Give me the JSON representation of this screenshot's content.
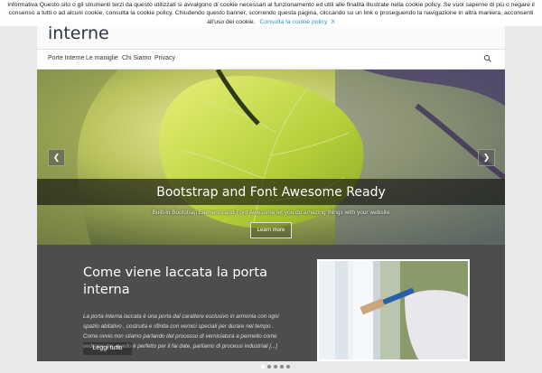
{
  "cookie_banner": {
    "text": "Informativa Questo sito o gli strumenti terzi da questo utilizzati si avvalgono di cookie necessari al funzionamento ed utili alle finalità illustrate nella cookie policy. Se vuoi saperne di più o negare il consenso a tutti o ad alcuni cookie, consulta la cookie policy. Chiudendo questo banner, scorrendo questa pagina, cliccando su un link o proseguendo la navigazione in altra maniera, acconsenti all'uso dei cookie.",
    "link_label": "Consulta la cookie policy",
    "close_label": "X"
  },
  "header": {
    "site_title": "interne"
  },
  "nav": {
    "items": [
      "Porte Interne",
      "Le maniglie",
      "Chi Siamo",
      "Privacy"
    ],
    "search_icon": "search-icon"
  },
  "slider": {
    "title": "Bootstrap and Font Awesome Ready",
    "text": "Built-in Bootstrap Elements and Font Awesome let you do amazing things with your website",
    "button_label": "Learn more",
    "prev_label": "❮",
    "next_label": "❯"
  },
  "post": {
    "title": "Come viene laccata la porta interna",
    "excerpt": "La porta interna laccata è una porta dal carattere esclusivo in armonia con ogni spazio abitativo , costruita e rifinita con vernici speciali per durare nel tempo . Come ovvio non stiamo parlando del processo di verniciatura a pennello come vediamo qui, quello è perfetto per il fai date, parliamo di processi industriali [...]",
    "read_more_label": "Leggi tutto"
  },
  "colors": {
    "accent": "#2d8fd3",
    "content_bg": "#4d4d4d"
  }
}
